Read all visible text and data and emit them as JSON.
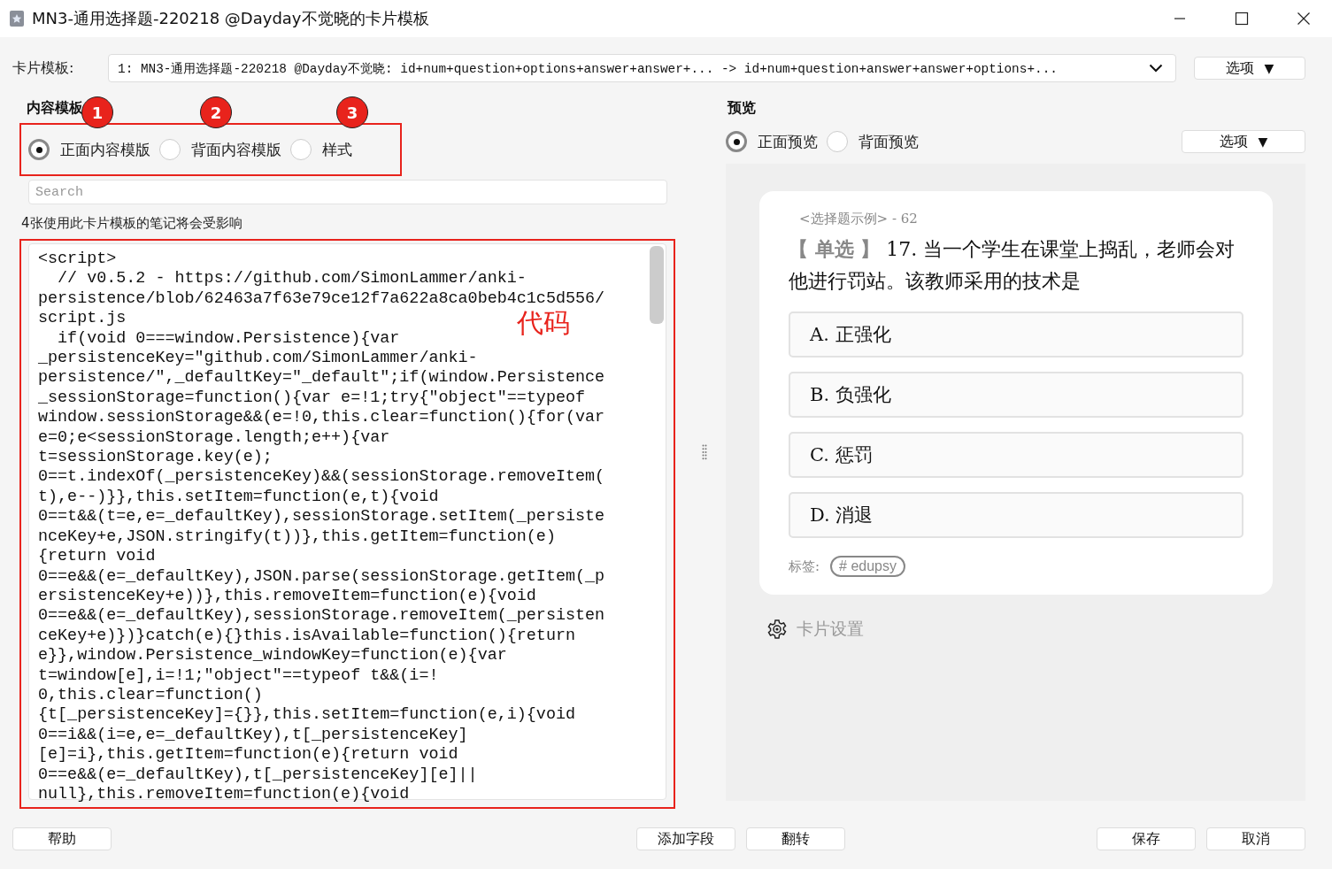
{
  "window": {
    "title": "MN3-通用选择题-220218 @Dayday不觉晓的卡片模板"
  },
  "note_type": {
    "label": "卡片模板:",
    "value": "1: MN3-通用选择题-220218 @Dayday不觉晓: id+num+question+options+answer+answer+... -> id+num+question+answer+answer+options+...",
    "options_button": {
      "label": "选项",
      "caret": "▼"
    }
  },
  "content_template": {
    "heading": "内容模板",
    "radios": [
      {
        "label": "正面内容模版",
        "selected": true
      },
      {
        "label": "背面内容模版",
        "selected": false
      },
      {
        "label": "样式",
        "selected": false
      }
    ],
    "search": {
      "placeholder": "Search"
    },
    "affected_notes": "4张使用此卡片模板的笔记将会受影响",
    "code_lines": [
      "<script>",
      "  // v0.5.2 - https://github.com/SimonLammer/anki-",
      "persistence/blob/62463a7f63e79ce12f7a622a8ca0beb4c1c5d556/",
      "script.js",
      "  if(void 0===window.Persistence){var",
      "_persistenceKey=\"github.com/SimonLammer/anki-",
      "persistence/\",_defaultKey=\"_default\";if(window.Persistence",
      "_sessionStorage=function(){var e=!1;try{\"object\"==typeof",
      "window.sessionStorage&&(e=!0,this.clear=function(){for(var",
      "e=0;e<sessionStorage.length;e++){var",
      "t=sessionStorage.key(e);",
      "0==t.indexOf(_persistenceKey)&&(sessionStorage.removeItem(",
      "t),e--)}},this.setItem=function(e,t){void",
      "0==t&&(t=e,e=_defaultKey),sessionStorage.setItem(_persiste",
      "nceKey+e,JSON.stringify(t))},this.getItem=function(e)",
      "{return void",
      "0==e&&(e=_defaultKey),JSON.parse(sessionStorage.getItem(_p",
      "ersistenceKey+e))},this.removeItem=function(e){void",
      "0==e&&(e=_defaultKey),sessionStorage.removeItem(_persisten",
      "ceKey+e)})}catch(e){}this.isAvailable=function(){return",
      "e}},window.Persistence_windowKey=function(e){var",
      "t=window[e],i=!1;\"object\"==typeof t&&(i=!",
      "0,this.clear=function()",
      "{t[_persistenceKey]={}},this.setItem=function(e,i){void",
      "0==i&&(i=e,e=_defaultKey),t[_persistenceKey]",
      "[e]=i},this.getItem=function(e){return void",
      "0==e&&(e=_defaultKey),t[_persistenceKey][e]||",
      "null},this.removeItem=function(e){void"
    ]
  },
  "preview": {
    "heading": "预览",
    "radios": [
      {
        "label": "正面预览",
        "selected": true
      },
      {
        "label": "背面预览",
        "selected": false
      }
    ],
    "options_button": {
      "label": "选项",
      "caret": "▼"
    },
    "card": {
      "deck": "<选择题示例> - 62",
      "type_tag": "【 单选 】",
      "question": "17. 当一个学生在课堂上捣乱，老师会对他进行罚站。该教师采用的技术是",
      "options": [
        "A. 正强化",
        "B. 负强化",
        "C. 惩罚",
        "D. 消退"
      ],
      "tags_label": "标签:",
      "tags": [
        "# edupsy"
      ]
    },
    "settings_link": "卡片设置"
  },
  "buttons": {
    "left": [
      "帮助"
    ],
    "center": [
      "添加字段",
      "翻转"
    ],
    "right": [
      "保存",
      "取消"
    ]
  },
  "annotations": {
    "markers": [
      "1",
      "2",
      "3"
    ],
    "code_label": "代码"
  }
}
